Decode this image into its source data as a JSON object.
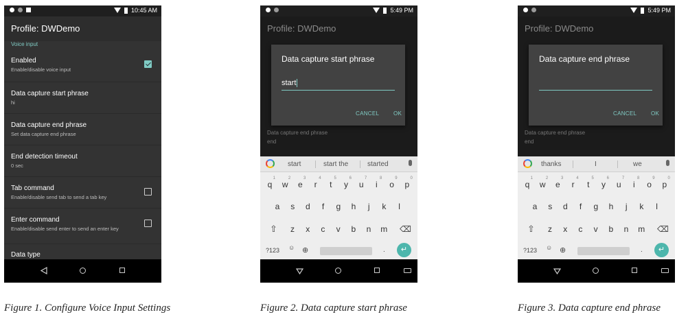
{
  "screens": [
    {
      "time": "10:45 AM",
      "app_title": "Profile: DWDemo",
      "section": "Voice input",
      "items": [
        {
          "title": "Enabled",
          "summary": "Enable/disable voice input",
          "checkbox": "checked"
        },
        {
          "title": "Data capture start phrase",
          "summary": "hi",
          "checkbox": "none"
        },
        {
          "title": "Data capture end phrase",
          "summary": "Set data capture end phrase",
          "checkbox": "none"
        },
        {
          "title": "End detection timeout",
          "summary": "0 sec",
          "checkbox": "none"
        },
        {
          "title": "Tab command",
          "summary": "Enable/disable send tab to send a tab key",
          "checkbox": "unchecked"
        },
        {
          "title": "Enter command",
          "summary": "Enable/disable send enter to send an enter key",
          "checkbox": "unchecked"
        },
        {
          "title": "Data type",
          "summary": "",
          "checkbox": "none"
        }
      ]
    },
    {
      "time": "5:49 PM",
      "app_title": "Profile: DWDemo",
      "behind_row": {
        "title": "Data capture end phrase",
        "summary": "end"
      },
      "dialog": {
        "title": "Data capture start phrase",
        "value": "start",
        "cancel": "CANCEL",
        "ok": "OK"
      },
      "suggestions": [
        "start",
        "start the",
        "started"
      ]
    },
    {
      "time": "5:49 PM",
      "app_title": "Profile: DWDemo",
      "behind_row": {
        "title": "Data capture end phrase",
        "summary": "end"
      },
      "dialog": {
        "title": "Data capture end phrase",
        "value": "",
        "cancel": "CANCEL",
        "ok": "OK"
      },
      "suggestions": [
        "thanks",
        "I",
        "we"
      ]
    }
  ],
  "keyboard": {
    "row1": [
      "q",
      "w",
      "e",
      "r",
      "t",
      "y",
      "u",
      "i",
      "o",
      "p"
    ],
    "row1_nums": [
      "1",
      "2",
      "3",
      "4",
      "5",
      "6",
      "7",
      "8",
      "9",
      "0"
    ],
    "row2": [
      "a",
      "s",
      "d",
      "f",
      "g",
      "h",
      "j",
      "k",
      "l"
    ],
    "row3": [
      "z",
      "x",
      "c",
      "v",
      "b",
      "n",
      "m"
    ],
    "symbols_key": "?123",
    "period_key": "."
  },
  "captions": [
    "Figure 1. Configure Voice Input Settings",
    "Figure 2. Data capture start phrase",
    "Figure 3. Data capture end phrase"
  ],
  "colors": {
    "accent": "#80cbc4",
    "enter_key": "#4db6ac",
    "background": "#333333"
  },
  "icons": [
    "location-icon",
    "notification-icon",
    "image-icon",
    "wifi-icon",
    "battery-icon",
    "back-icon",
    "home-icon",
    "recents-icon",
    "keyboard-icon",
    "google-icon",
    "mic-icon",
    "shift-icon",
    "backspace-icon",
    "emoji-icon",
    "globe-icon",
    "enter-icon"
  ]
}
